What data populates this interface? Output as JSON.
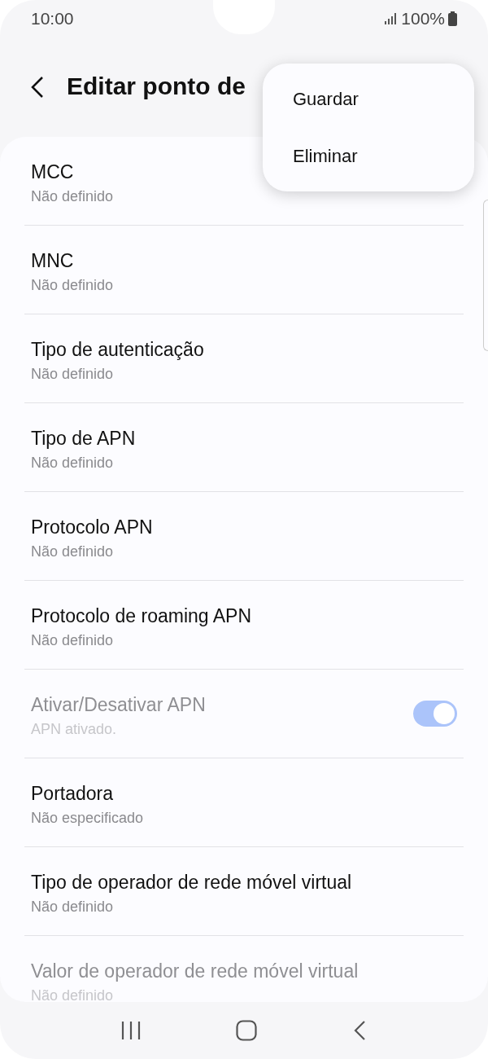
{
  "status_bar": {
    "time": "10:00",
    "battery": "100%"
  },
  "header": {
    "title": "Editar ponto de"
  },
  "menu": {
    "items": [
      {
        "label": "Guardar"
      },
      {
        "label": "Eliminar"
      }
    ]
  },
  "settings": [
    {
      "kind": "text",
      "title": "MCC",
      "subtitle": "Não definido",
      "disabled": false
    },
    {
      "kind": "text",
      "title": "MNC",
      "subtitle": "Não definido",
      "disabled": false
    },
    {
      "kind": "text",
      "title": "Tipo de autenticação",
      "subtitle": "Não definido",
      "disabled": false
    },
    {
      "kind": "text",
      "title": "Tipo de APN",
      "subtitle": "Não definido",
      "disabled": false
    },
    {
      "kind": "text",
      "title": "Protocolo APN",
      "subtitle": "Não definido",
      "disabled": false
    },
    {
      "kind": "text",
      "title": "Protocolo de roaming APN",
      "subtitle": "Não definido",
      "disabled": false
    },
    {
      "kind": "toggle",
      "title": "Ativar/Desativar APN",
      "subtitle": "APN ativado.",
      "disabled": true,
      "on": true
    },
    {
      "kind": "text",
      "title": "Portadora",
      "subtitle": "Não especificado",
      "disabled": false
    },
    {
      "kind": "text",
      "title": "Tipo de operador de rede móvel virtual",
      "subtitle": "Não definido",
      "disabled": false
    },
    {
      "kind": "text",
      "title": "Valor de operador de rede móvel virtual",
      "subtitle": "Não definido",
      "disabled": true
    }
  ]
}
